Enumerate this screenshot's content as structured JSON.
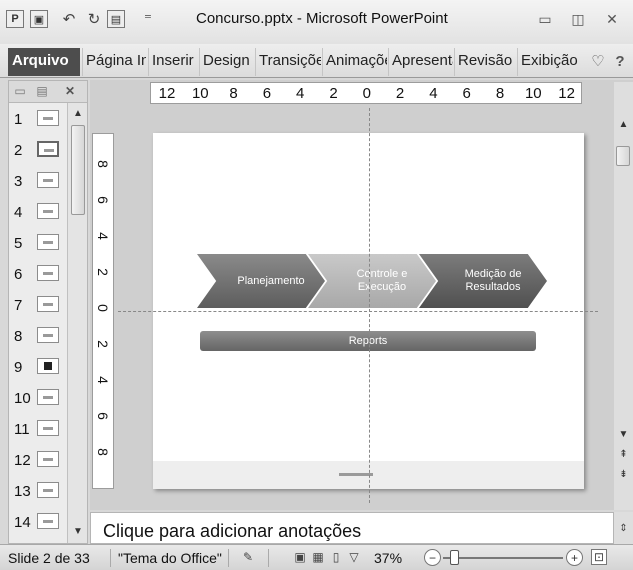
{
  "window": {
    "title": "Concurso.pptx - Microsoft PowerPoint",
    "minimize_icon": "minimize-icon",
    "restore_icon": "restore-icon",
    "close_icon": "close-icon"
  },
  "quick_access": [
    {
      "name": "powerpoint-app-icon",
      "glyph": "P"
    },
    {
      "name": "save-icon",
      "glyph": "▣"
    },
    {
      "name": "undo-icon",
      "glyph": "↶"
    },
    {
      "name": "redo-icon",
      "glyph": "↻"
    },
    {
      "name": "slideshow-icon",
      "glyph": "▤"
    },
    {
      "name": "customize-toolbar-icon",
      "glyph": "⁼"
    }
  ],
  "ribbon_tabs": [
    "Arquivo",
    "Página Inicial",
    "Inserir",
    "Design",
    "Transições",
    "Animações",
    "Apresentação de Slides",
    "Revisão",
    "Exibição"
  ],
  "ribbon_icons": {
    "minimize_ribbon": "chevron-down-icon",
    "help": "help-icon"
  },
  "thumbnails": {
    "numbers": [
      "1",
      "2",
      "3",
      "4",
      "5",
      "6",
      "7",
      "8",
      "9",
      "10",
      "11",
      "12",
      "13",
      "14"
    ],
    "selected": "2"
  },
  "ruler": {
    "horizontal": [
      "12",
      "10",
      "8",
      "6",
      "4",
      "2",
      "0",
      "2",
      "4",
      "6",
      "8",
      "10",
      "12"
    ],
    "vertical": [
      "8",
      "6",
      "4",
      "2",
      "0",
      "2",
      "4",
      "6",
      "8"
    ]
  },
  "slide": {
    "steps": [
      {
        "line1": "Planejamento",
        "line2": ""
      },
      {
        "line1": "Controle e",
        "line2": "Execução"
      },
      {
        "line1": "Medição de",
        "line2": "Resultados"
      }
    ],
    "bar_label": "Reports"
  },
  "notes": {
    "placeholder": "Clique para adicionar anotações"
  },
  "status": {
    "slide_info": "Slide 2 de 33",
    "theme": "\"Tema do Office\"",
    "zoom": "37%",
    "zoom_level": 0.37,
    "accent": "#4d4d4d"
  }
}
